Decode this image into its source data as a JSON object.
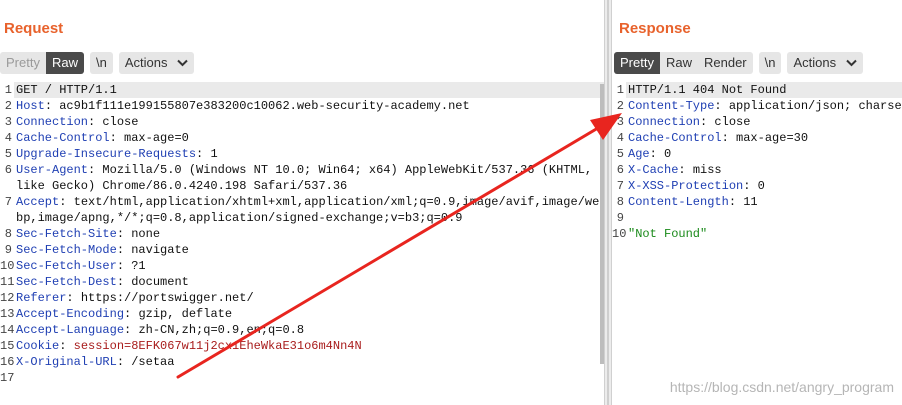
{
  "request": {
    "title": "Request",
    "toolbar": {
      "pretty": "Pretty",
      "raw": "Raw",
      "newline": "\\n",
      "actions": "Actions"
    },
    "lines": [
      {
        "n": "1",
        "name": "",
        "sep": "",
        "value": "GET / HTTP/1.1"
      },
      {
        "n": "2",
        "name": "Host",
        "sep": ": ",
        "value": "ac9b1f111e199155807e383200c10062.web-security-academy.net"
      },
      {
        "n": "3",
        "name": "Connection",
        "sep": ": ",
        "value": "close"
      },
      {
        "n": "4",
        "name": "Cache-Control",
        "sep": ": ",
        "value": "max-age=0"
      },
      {
        "n": "5",
        "name": "Upgrade-Insecure-Requests",
        "sep": ": ",
        "value": "1"
      },
      {
        "n": "6",
        "name": "User-Agent",
        "sep": ": ",
        "value": "Mozilla/5.0 (Windows NT 10.0; Win64; x64) AppleWebKit/537.36 (KHTML, like Gecko) Chrome/86.0.4240.198 Safari/537.36"
      },
      {
        "n": "7",
        "name": "Accept",
        "sep": ": ",
        "value": "text/html,application/xhtml+xml,application/xml;q=0.9,image/avif,image/webp,image/apng,*/*;q=0.8,application/signed-exchange;v=b3;q=0.9"
      },
      {
        "n": "8",
        "name": "Sec-Fetch-Site",
        "sep": ": ",
        "value": "none"
      },
      {
        "n": "9",
        "name": "Sec-Fetch-Mode",
        "sep": ": ",
        "value": "navigate"
      },
      {
        "n": "10",
        "name": "Sec-Fetch-User",
        "sep": ": ",
        "value": "?1"
      },
      {
        "n": "11",
        "name": "Sec-Fetch-Dest",
        "sep": ": ",
        "value": "document"
      },
      {
        "n": "12",
        "name": "Referer",
        "sep": ": ",
        "value": "https://portswigger.net/"
      },
      {
        "n": "13",
        "name": "Accept-Encoding",
        "sep": ": ",
        "value": "gzip, deflate"
      },
      {
        "n": "14",
        "name": "Accept-Language",
        "sep": ": ",
        "value": "zh-CN,zh;q=0.9,en;q=0.8"
      },
      {
        "n": "15",
        "name": "Cookie",
        "sep": ": ",
        "value": "session=8EFK067w11j2cx1EheWkaE31o6m4Nn4N"
      },
      {
        "n": "16",
        "name": "X-Original-URL",
        "sep": ": ",
        "value": "/setaa"
      },
      {
        "n": "17",
        "name": "",
        "sep": "",
        "value": ""
      }
    ]
  },
  "response": {
    "title": "Response",
    "toolbar": {
      "pretty": "Pretty",
      "raw": "Raw",
      "render": "Render",
      "newline": "\\n",
      "actions": "Actions"
    },
    "lines": [
      {
        "n": "1",
        "name": "",
        "sep": "",
        "value": "HTTP/1.1 404 Not Found"
      },
      {
        "n": "2",
        "name": "Content-Type",
        "sep": ": ",
        "value": "application/json; charset"
      },
      {
        "n": "3",
        "name": "Connection",
        "sep": ": ",
        "value": "close"
      },
      {
        "n": "4",
        "name": "Cache-Control",
        "sep": ": ",
        "value": "max-age=30"
      },
      {
        "n": "5",
        "name": "Age",
        "sep": ": ",
        "value": "0"
      },
      {
        "n": "6",
        "name": "X-Cache",
        "sep": ": ",
        "value": "miss"
      },
      {
        "n": "7",
        "name": "X-XSS-Protection",
        "sep": ": ",
        "value": "0"
      },
      {
        "n": "8",
        "name": "Content-Length",
        "sep": ": ",
        "value": "11"
      },
      {
        "n": "9",
        "name": "",
        "sep": "",
        "value": ""
      },
      {
        "n": "10",
        "name": "",
        "sep": "",
        "value": "\"Not Found\""
      }
    ]
  },
  "watermark": "https://blog.csdn.net/angry_program",
  "colors": {
    "title": "#e8622c",
    "header_name": "#1f3fb3",
    "cookie_value": "#a81c1c",
    "string_value": "#1a8a1a",
    "annotation_arrow": "#e8251f",
    "active_button": "#4a4a4a"
  },
  "icons": {
    "actions_chevron": "chevron-down-icon",
    "annotation": "red-arrow-annotation"
  }
}
